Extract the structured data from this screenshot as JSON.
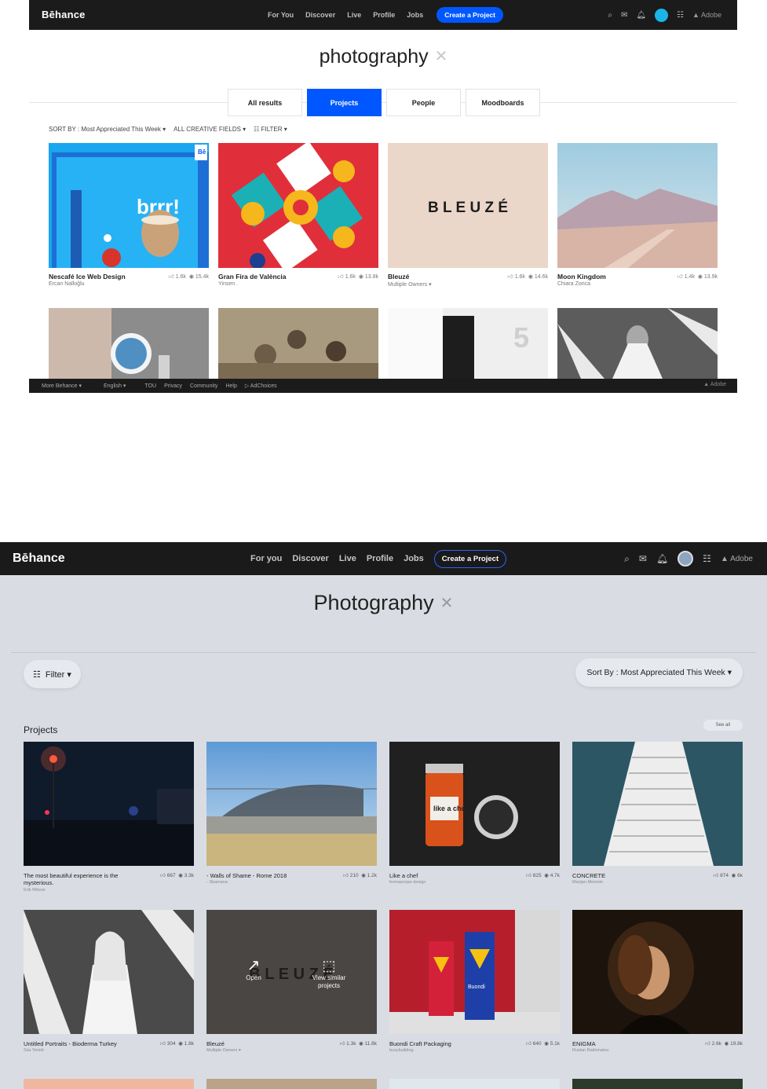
{
  "v1": {
    "nav": {
      "logo": "Bēhance",
      "links": [
        "For You",
        "Discover",
        "Live",
        "Profile",
        "Jobs"
      ],
      "create": "Create a Project",
      "adobe": "Adobe"
    },
    "query": "photography",
    "tabs": [
      "All results",
      "Projects",
      "People",
      "Moodboards"
    ],
    "sort": {
      "sort_by": "SORT BY : Most Appreciated This Week ▾",
      "fields": "ALL CREATIVE FIELDS ▾",
      "filter": "FILTER ▾"
    },
    "projects": [
      {
        "title": "Nescafé Ice Web Design",
        "owner": "Ercan Nalloğlu",
        "likes": "1.6k",
        "views": "15.4k"
      },
      {
        "title": "Gran Fira de València",
        "owner": "Yinsen .",
        "likes": "1.6k",
        "views": "13.8k"
      },
      {
        "title": "Bleuzé",
        "owner": "Multiple Owners ▾",
        "likes": "1.6k",
        "views": "14.6k"
      },
      {
        "title": "Moon Kingdom",
        "owner": "Chiara Zonca",
        "likes": "1.4k",
        "views": "13.9k"
      }
    ],
    "footer": {
      "items": [
        "More Behance ▾",
        "English ▾",
        "TOU",
        "Privacy",
        "Community",
        "Help",
        "AdChoices"
      ],
      "adobe": "Adobe"
    }
  },
  "v2": {
    "nav": {
      "logo": "Bēhance",
      "links": [
        "For you",
        "Discover",
        "Live",
        "Profile",
        "Jobs"
      ],
      "create": "Create a Project",
      "adobe": "Adobe"
    },
    "query": "Photography",
    "filter": "Filter ▾",
    "sort": "Sort By : Most Appreciated This Week ▾",
    "section": "Projects",
    "see_all": "See all",
    "projects": [
      {
        "title": "The most beautiful experience is the mysterious.",
        "owner": "Erik Witsoe",
        "likes": "667",
        "views": "3.3k"
      },
      {
        "title": "- Walls of Shame - Rome 2018",
        "owner": "- Sbamana",
        "likes": "210",
        "views": "1.2k"
      },
      {
        "title": "Like a chef",
        "owner": "formascope design",
        "likes": "825",
        "views": "4.7k"
      },
      {
        "title": "CONCRETE",
        "owner": "Marijan Moneim",
        "likes": "874",
        "views": "6k"
      },
      {
        "title": "Untitled Portraits - Bioderma Turkey",
        "owner": "Sıla Yenidi",
        "likes": "304",
        "views": "1.8k"
      },
      {
        "title": "Bleuzé",
        "owner": "Multiple Owners ▾",
        "likes": "1.3k",
        "views": "11.8k"
      },
      {
        "title": "Buondi Craft Packaging",
        "owner": "busybuilding",
        "likes": "640",
        "views": "5.1k"
      },
      {
        "title": "ENIGMA",
        "owner": "Ruslan Rakhmatov",
        "likes": "2.6k",
        "views": "19.8k"
      }
    ],
    "hover": {
      "open": "Open",
      "similar": "View similar projects"
    },
    "thumb_text": {
      "brrr": "brrr!",
      "bleuze": "B L E U Z É",
      "likeachef": "like a chef",
      "buondi": "Buondi"
    }
  }
}
